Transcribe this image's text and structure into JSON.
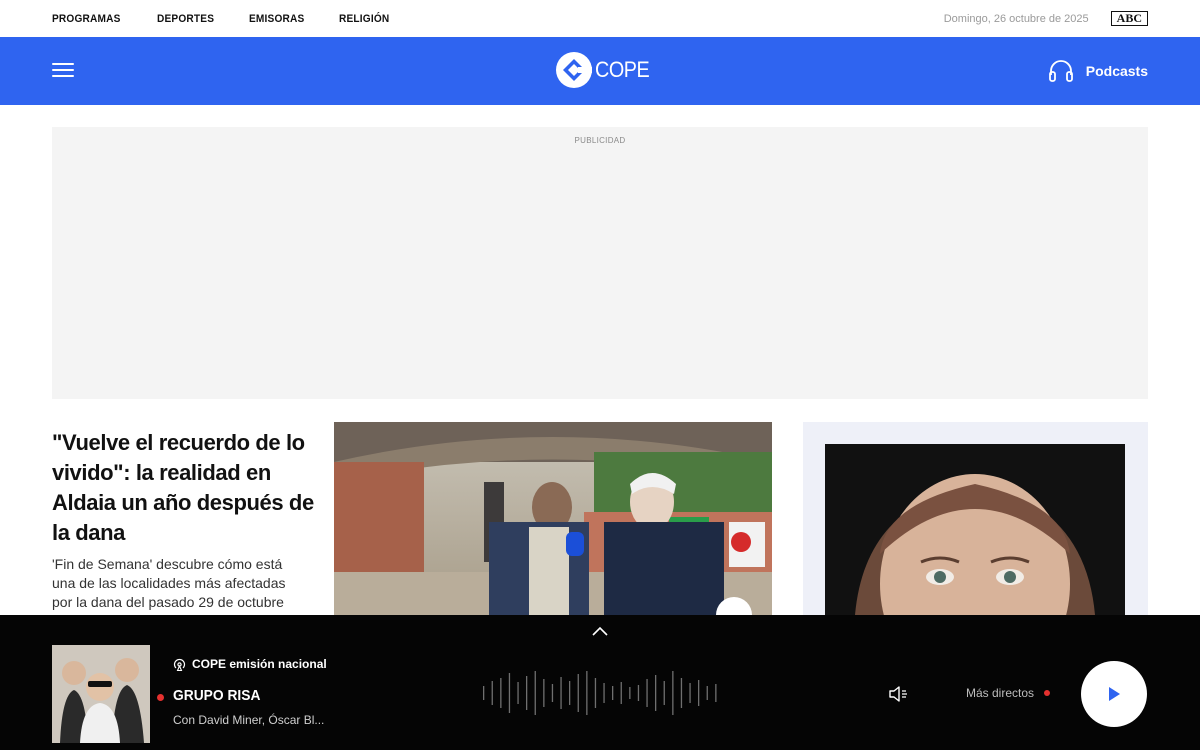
{
  "topbar": {
    "nav": [
      "PROGRAMAS",
      "DEPORTES",
      "EMISORAS",
      "RELIGIÓN"
    ],
    "date": "Domingo, 26 octubre de 2025",
    "abc": "ABC"
  },
  "header": {
    "logo_text": "COPE",
    "podcasts_label": "Podcasts",
    "brand_color": "#2f64f0"
  },
  "ad": {
    "label": "PUBLICIDAD"
  },
  "article": {
    "headline": "\"Vuelve el recuerdo de lo vivido\": la realidad en Aldaia un año después de la dana",
    "summary": "'Fin de Semana' descubre cómo está una de las localidades más afectadas por la dana del pasado 29 de octubre"
  },
  "player": {
    "emission": "COPE emisión nacional",
    "program_title": "GRUPO RISA",
    "program_subtitle": "Con David Miner, Óscar Bl...",
    "more_live": "Más directos",
    "live_color": "#e5312f"
  },
  "icons": {
    "menu": "hamburger-icon",
    "podcasts": "headphones-icon",
    "collapse": "chevron-up-icon",
    "emission": "radio-broadcast-icon",
    "volume": "speaker-muted-icon",
    "play": "play-icon"
  }
}
